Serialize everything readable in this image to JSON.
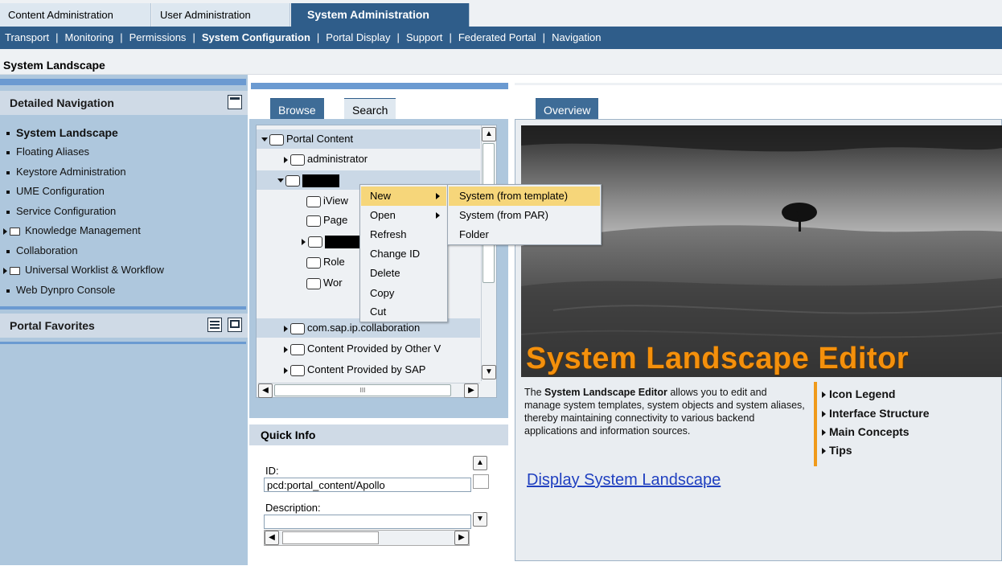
{
  "top_tabs": [
    {
      "label": "Content Administration",
      "active": false
    },
    {
      "label": "User Administration",
      "active": false
    },
    {
      "label": "System Administration",
      "active": true
    }
  ],
  "subnav": [
    {
      "label": "Transport"
    },
    {
      "label": "Monitoring"
    },
    {
      "label": "Permissions"
    },
    {
      "label": "System Configuration",
      "active": true
    },
    {
      "label": "Portal Display"
    },
    {
      "label": "Support"
    },
    {
      "label": "Federated Portal"
    },
    {
      "label": "Navigation"
    }
  ],
  "subnav_separator": "|",
  "page_title": "System Landscape",
  "detailed_navigation": {
    "title": "Detailed Navigation",
    "items": [
      {
        "label": "System Landscape",
        "selected": true,
        "type": "bullet"
      },
      {
        "label": "Floating Aliases",
        "type": "bullet"
      },
      {
        "label": "Keystore Administration",
        "type": "bullet"
      },
      {
        "label": "UME Configuration",
        "type": "bullet"
      },
      {
        "label": "Service Configuration",
        "type": "bullet"
      },
      {
        "label": "Knowledge Management",
        "type": "folder"
      },
      {
        "label": "Collaboration",
        "type": "bullet"
      },
      {
        "label": "Universal Worklist & Workflow",
        "type": "folder"
      },
      {
        "label": "Web Dynpro Console",
        "type": "bullet"
      }
    ]
  },
  "portal_favorites": {
    "title": "Portal Favorites"
  },
  "browse_tabs": {
    "browse": "Browse",
    "search": "Search"
  },
  "tree": {
    "rows": [
      {
        "label": "Portal Content",
        "expanded": true,
        "indent": 0
      },
      {
        "label": "administrator",
        "expanded": false,
        "indent": 1
      },
      {
        "label": "",
        "expanded": true,
        "indent": 1,
        "redacted": true
      },
      {
        "label": "iView",
        "indent": 2
      },
      {
        "label": "Page",
        "indent": 2
      },
      {
        "label": "",
        "indent": 2,
        "redacted": true,
        "expanded": false
      },
      {
        "label": "Role",
        "indent": 2
      },
      {
        "label": "Wor",
        "indent": 2
      },
      {
        "label": "com.sap.ip.collaboration",
        "expanded": false,
        "indent": 1
      },
      {
        "label": "Content Provided by Other V",
        "expanded": false,
        "indent": 1
      },
      {
        "label": "Content Provided by SAP",
        "expanded": false,
        "indent": 1
      }
    ],
    "hscroll_grip": "III"
  },
  "context_menu": {
    "items": [
      {
        "label": "New",
        "submenu": true,
        "highlighted": true
      },
      {
        "label": "Open",
        "submenu": true
      },
      {
        "label": "Refresh"
      },
      {
        "label": "Change ID"
      },
      {
        "label": "Delete"
      },
      {
        "label": "Copy"
      },
      {
        "label": "Cut"
      }
    ]
  },
  "submenu": {
    "items": [
      {
        "label": "System (from template)",
        "highlighted": true
      },
      {
        "label": "System (from PAR)"
      },
      {
        "label": "Folder"
      }
    ]
  },
  "quick_info": {
    "title": "Quick Info",
    "id_label": "ID:",
    "id_value": "pcd:portal_content/Apollo",
    "description_label": "Description:",
    "description_value": ""
  },
  "overview": {
    "tab": "Overview",
    "headline": "System Landscape Editor",
    "description_prefix": "The ",
    "description_bold": "System Landscape Editor",
    "description_rest": " allows you to edit and manage system templates, system objects and system aliases, thereby maintaining connectivity to various backend applications and information sources.",
    "links": [
      "Icon Legend",
      "Interface Structure",
      "Main Concepts",
      "Tips"
    ],
    "display_link": "Display System Landscape"
  },
  "colors": {
    "accent_blue": "#2f5d8a",
    "highlight": "#f6d67a",
    "headline_orange": "#f4900c"
  }
}
